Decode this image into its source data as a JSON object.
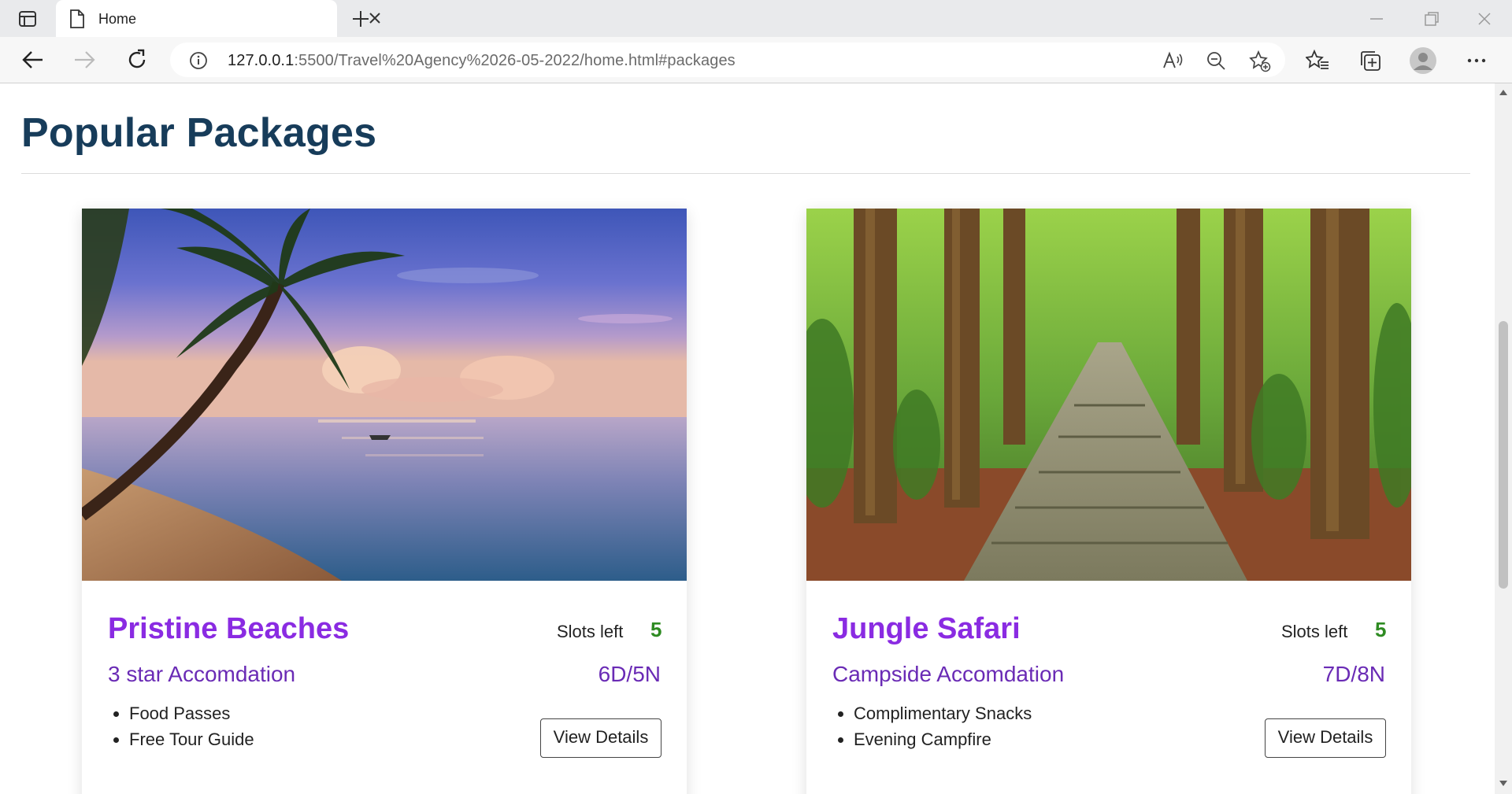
{
  "browser": {
    "tab_title": "Home",
    "url_host": "127.0.0.1",
    "url_rest": ":5500/Travel%20Agency%2026-05-2022/home.html#packages"
  },
  "page": {
    "section_title": "Popular Packages",
    "packages": [
      {
        "name": "Pristine Beaches",
        "slots_label": "Slots left",
        "slots_count": "5",
        "accommodation": "3 star Accomdation",
        "duration": "6D/5N",
        "features": [
          "Food Passes",
          "Free Tour Guide"
        ],
        "button_label": "View Details"
      },
      {
        "name": "Jungle Safari",
        "slots_label": "Slots left",
        "slots_count": "5",
        "accommodation": "Campside Accomdation",
        "duration": "7D/8N",
        "features": [
          "Complimentary Snacks",
          "Evening Campfire"
        ],
        "button_label": "View Details"
      }
    ]
  },
  "colors": {
    "title": "#173c5a",
    "package_name": "#8a2be2",
    "accent_text": "#6a2bb5",
    "slots_count": "#2e8b22"
  },
  "icons": [
    "tab-actions-icon",
    "page-icon",
    "close-icon",
    "plus-icon",
    "minimize-icon",
    "restore-icon",
    "window-close-icon",
    "back-icon",
    "forward-icon",
    "reload-icon",
    "info-icon",
    "read-aloud-icon",
    "zoom-out-icon",
    "add-favorite-icon",
    "favorites-icon",
    "collections-icon",
    "profile-icon",
    "more-icon"
  ]
}
